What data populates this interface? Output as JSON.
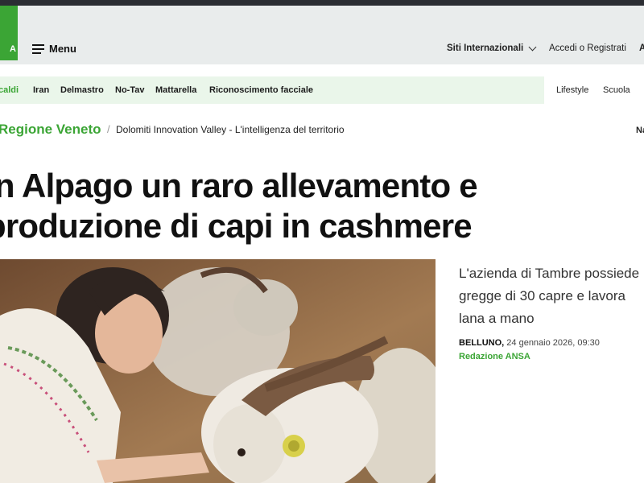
{
  "header": {
    "logo_text": "A",
    "menu_label": "Menu",
    "siti_label": "Siti Internazionali",
    "login_label": "Accedi o Registrati",
    "right_cut_label": "A"
  },
  "tags": {
    "items": [
      {
        "label": "caldi"
      },
      {
        "label": "Iran"
      },
      {
        "label": "Delmastro"
      },
      {
        "label": "No-Tav"
      },
      {
        "label": "Mattarella"
      },
      {
        "label": "Riconoscimento facciale"
      }
    ],
    "right": [
      {
        "label": "Lifestyle"
      },
      {
        "label": "Scuola"
      }
    ]
  },
  "breadcrumb": {
    "region": "Regione Veneto",
    "separator": "/",
    "section": "Dolomiti Innovation Valley - L'intelligenza del territorio",
    "right_cut": "Na"
  },
  "article": {
    "headline": "In Alpago un raro allevamento e produzione di capi in cashmere",
    "subtitle": "L'azienda di Tambre possiede\ngregge di 30 capre e lavora\nlana a mano",
    "location": "BELLUNO,",
    "date": " 24 gennaio 2026, 09:30",
    "author": "Redazione ANSA"
  },
  "colors": {
    "brand_green": "#3ba535",
    "topbar": "#2b2d33",
    "header_bg": "#e9ecec",
    "tagbar_bg": "#eaf6ea"
  }
}
